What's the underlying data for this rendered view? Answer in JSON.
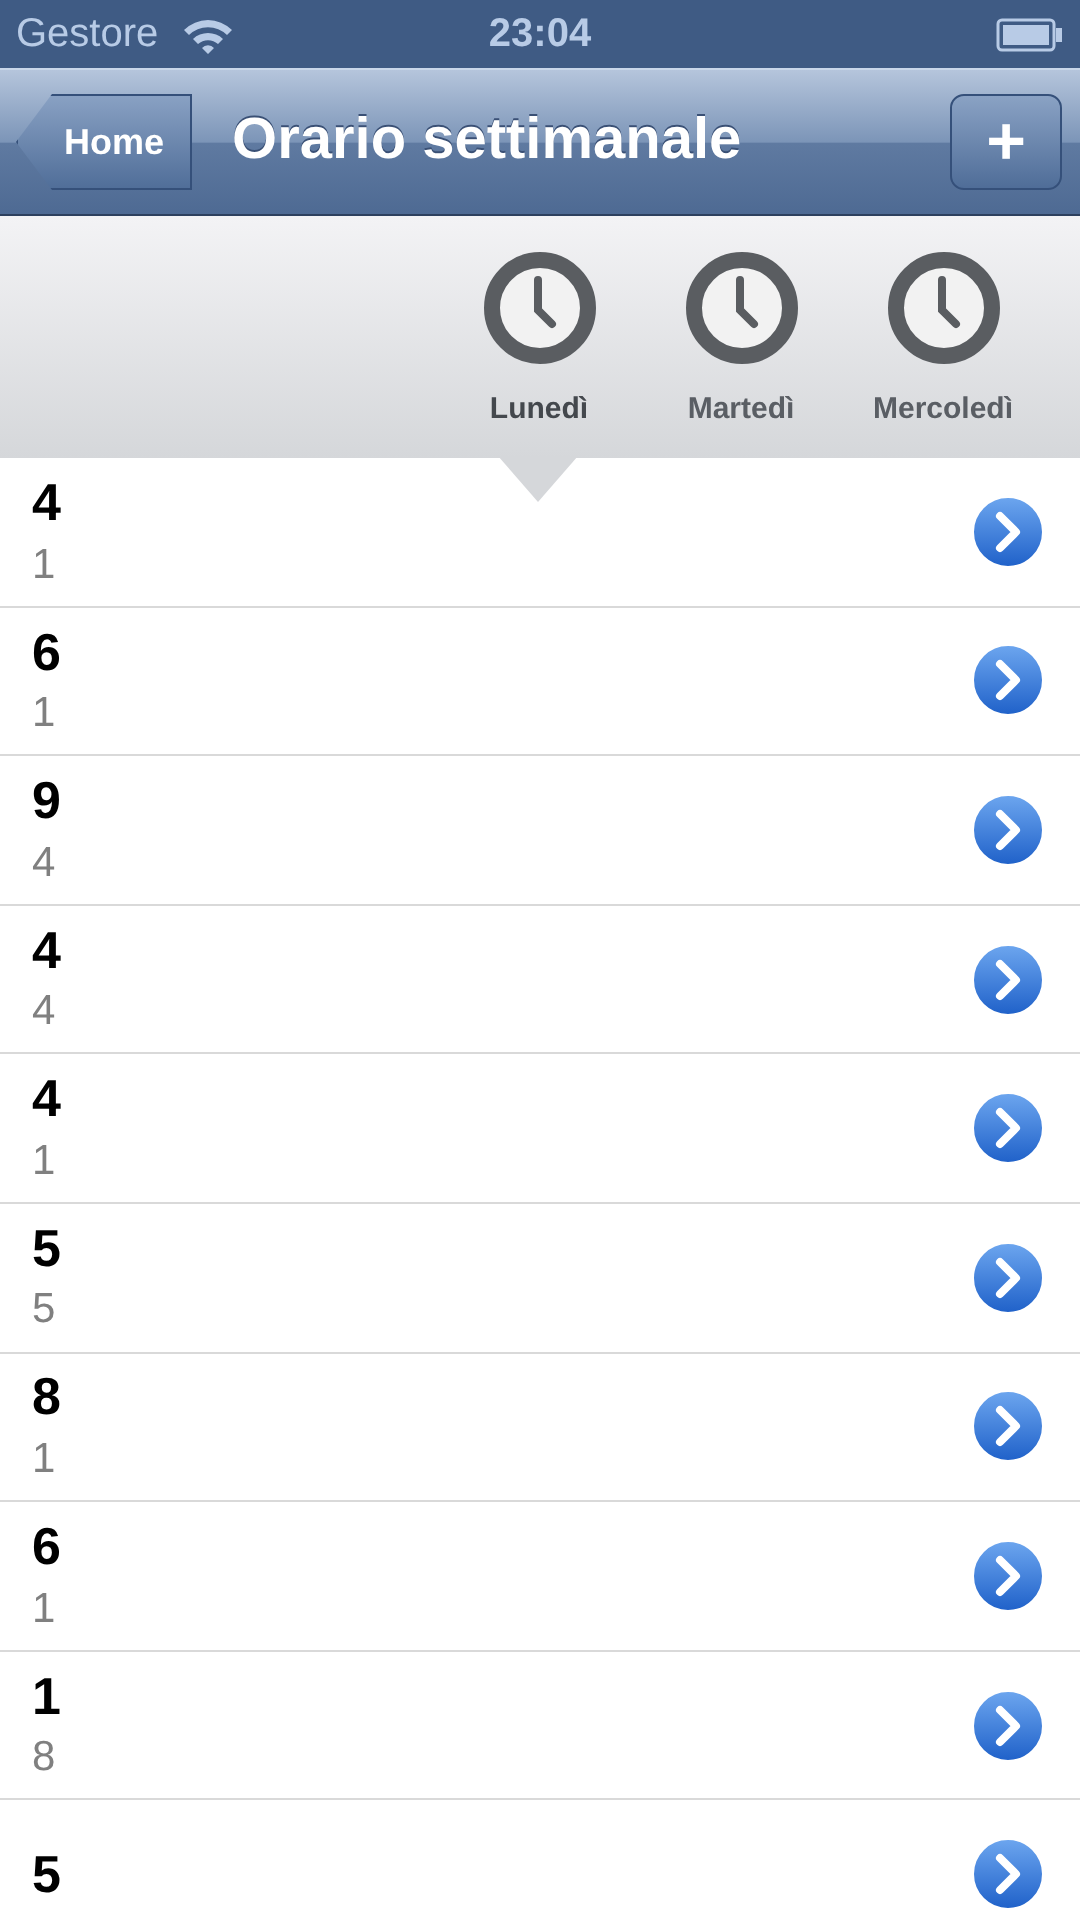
{
  "status_bar": {
    "carrier": "Gestore",
    "time": "23:04"
  },
  "nav_bar": {
    "back": "Home",
    "title": "Orario settimanale",
    "action": "+"
  },
  "tabs": [
    {
      "label": "Lunedì",
      "selected": true
    },
    {
      "label": "Martedì",
      "selected": false
    },
    {
      "label": "Mercoledì",
      "selected": false
    }
  ],
  "rows": [
    {
      "title": "4",
      "subtitle": "1"
    },
    {
      "title": "6",
      "subtitle": "1"
    },
    {
      "title": "9",
      "subtitle": "4"
    },
    {
      "title": "4",
      "subtitle": "4"
    },
    {
      "title": "4",
      "subtitle": "1"
    },
    {
      "title": "5",
      "subtitle": "5"
    },
    {
      "title": "8",
      "subtitle": "1"
    },
    {
      "title": "6",
      "subtitle": "1"
    },
    {
      "title": "1",
      "subtitle": "8"
    },
    {
      "title": "5"
    }
  ]
}
